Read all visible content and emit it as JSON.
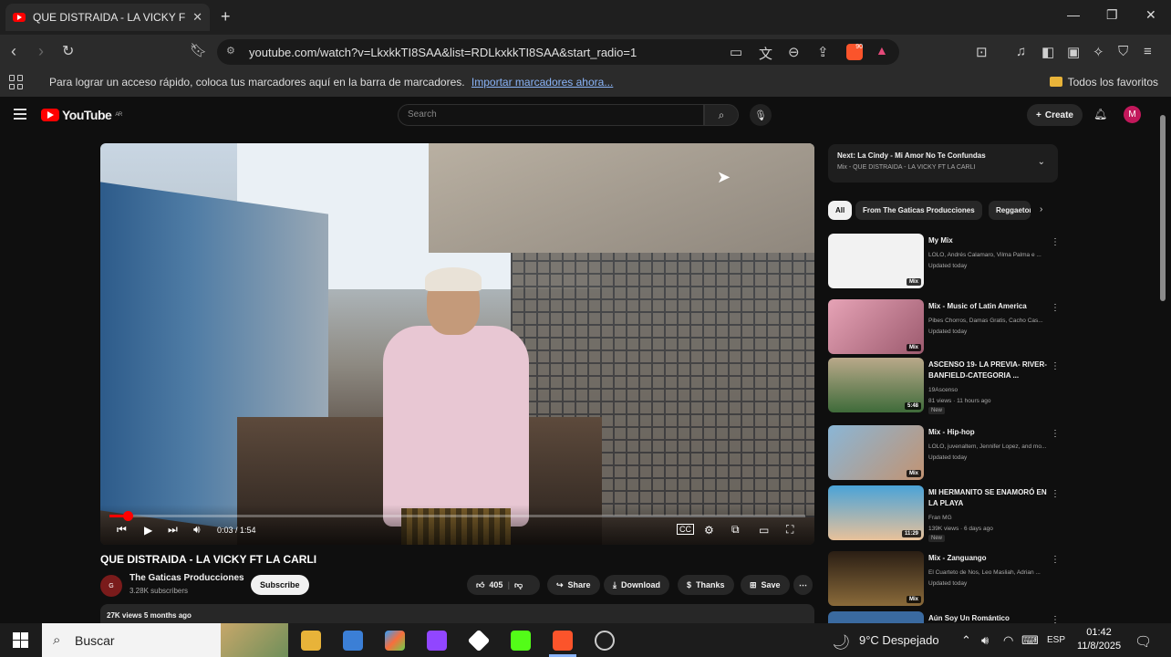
{
  "browser": {
    "tab_title": "QUE DISTRAIDA - LA VICKY FT L",
    "tab_close": "✕",
    "new_tab": "+",
    "url": "youtube.com/watch?v=LkxkkTI8SAA&list=RDLkxkkTI8SAA&start_radio=1",
    "bookmarks_message": "Para lograr un acceso rápido, coloca tus marcadores aquí en la barra de marcadores.",
    "bookmarks_link": "Importar marcadores ahora...",
    "favorites_label": "Todos los favoritos",
    "shield_count": "90"
  },
  "youtube": {
    "logo_text": "YouTube",
    "logo_region": "AR",
    "search_placeholder": "Search",
    "create_label": "Create",
    "avatar_letter": "M"
  },
  "player": {
    "time": "0:03 / 1:54",
    "progress_fraction": 0.026
  },
  "video": {
    "title": "QUE DISTRAIDA - LA VICKY FT LA CARLI",
    "channel": "The Gaticas Producciones",
    "subscribers": "3.28K subscribers",
    "subscribe_label": "Subscribe",
    "likes": "405",
    "share_label": "Share",
    "download_label": "Download",
    "thanks_label": "Thanks",
    "save_label": "Save",
    "views_date": "27K views  5 months ago"
  },
  "sidebar": {
    "next_title": "Next: La Cindy - Mi Amor No Te Confundas",
    "next_sub": "Mix - QUE DISTRAIDA - LA VICKY FT LA CARLI",
    "chips": [
      "All",
      "From The Gaticas Producciones",
      "Reggaeton"
    ],
    "items": [
      {
        "title": "My Mix",
        "sub": "LOLO, Andrés Calamaro, Vilma Palma e ...",
        "meta": "Updated today",
        "badge": "Mix",
        "new": ""
      },
      {
        "title": "Mix - Music of Latin America",
        "sub": "Pibes Chorros, Damas Gratis, Cacho Cas...",
        "meta": "Updated today",
        "badge": "Mix",
        "new": ""
      },
      {
        "title": "ASCENSO 19- LA PREVIA- RIVER-BANFIELD-CATEGORIA ...",
        "sub": "19Ascenso",
        "meta": "81 views · 11 hours ago",
        "badge": "5:48",
        "new": "New"
      },
      {
        "title": "Mix - Hip-hop",
        "sub": "LOLO, juvenaltem, Jennifer Lopez, and mo...",
        "meta": "Updated today",
        "badge": "Mix",
        "new": ""
      },
      {
        "title": "MI HERMANITO SE ENAMORÓ EN LA PLAYA",
        "sub": "Fran MG",
        "meta": "139K views · 6 days ago",
        "badge": "11:29",
        "new": "New"
      },
      {
        "title": "Mix - Zanguango",
        "sub": "El Cuarteto de Nos, Leo Masliah, Adrian ...",
        "meta": "Updated today",
        "badge": "Mix",
        "new": ""
      },
      {
        "title": "Aún Soy Un Romántico",
        "sub": "",
        "meta": "",
        "badge": "",
        "new": ""
      }
    ]
  },
  "taskbar": {
    "search_label": "Buscar",
    "weather": "9°C  Despejado",
    "language": "ESP",
    "time": "01:42",
    "date": "11/8/2025"
  }
}
